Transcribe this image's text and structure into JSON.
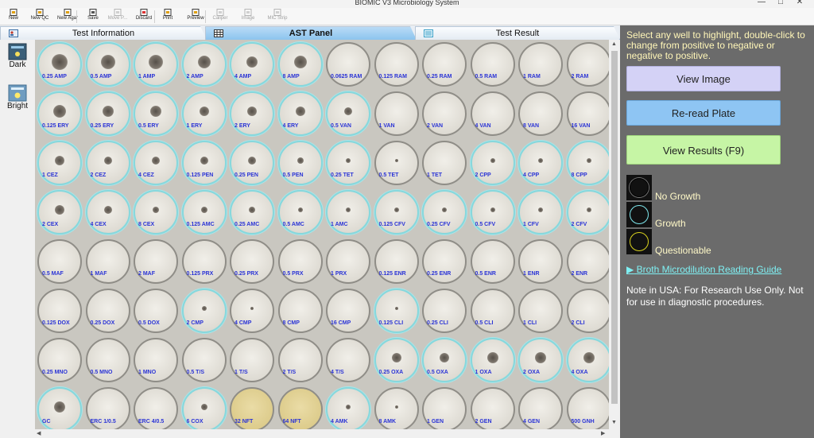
{
  "window": {
    "title": "BIOMIC V3 Microbiology System"
  },
  "toolbar": {
    "items": [
      {
        "label": "New",
        "icon": "new-file-icon",
        "disabled": false
      },
      {
        "label": "New QC",
        "icon": "qc-icon",
        "disabled": false
      },
      {
        "label": "New Agar",
        "icon": "agar-icon",
        "disabled": false
      },
      {
        "label": "Save",
        "icon": "save-icon",
        "disabled": false
      },
      {
        "label": "Move P...",
        "icon": "move-icon",
        "disabled": true
      },
      {
        "label": "Discard",
        "icon": "discard-icon",
        "disabled": false
      },
      {
        "label": "Print",
        "icon": "print-icon",
        "disabled": false
      },
      {
        "label": "Preview",
        "icon": "preview-icon",
        "disabled": false
      },
      {
        "label": "Caliper",
        "icon": "caliper-icon",
        "disabled": true
      },
      {
        "label": "Image",
        "icon": "image-icon",
        "disabled": true
      },
      {
        "label": "MIC Strip",
        "icon": "mic-strip-icon",
        "disabled": true
      }
    ]
  },
  "tabs": [
    {
      "label": "Test Information",
      "active": false
    },
    {
      "label": "AST Panel",
      "active": true
    },
    {
      "label": "Test Result",
      "active": false
    }
  ],
  "left_panel": {
    "dark_label": "Dark",
    "bright_label": "Bright"
  },
  "plate": {
    "rows": [
      [
        {
          "label": "0.25 AMP",
          "growth": true,
          "button": 20
        },
        {
          "label": "0.5 AMP",
          "growth": true,
          "button": 18
        },
        {
          "label": "1 AMP",
          "growth": true,
          "button": 18
        },
        {
          "label": "2 AMP",
          "growth": true,
          "button": 16
        },
        {
          "label": "4 AMP",
          "growth": true,
          "button": 14
        },
        {
          "label": "8 AMP",
          "growth": true,
          "button": 16
        },
        {
          "label": "0.0625 RAM",
          "growth": false,
          "button": 0
        },
        {
          "label": "0.125 RAM",
          "growth": false,
          "button": 0
        },
        {
          "label": "0.25 RAM",
          "growth": false,
          "button": 0
        },
        {
          "label": "0.5 RAM",
          "growth": false,
          "button": 0
        },
        {
          "label": "1 RAM",
          "growth": false,
          "button": 0
        },
        {
          "label": "2 RAM",
          "growth": false,
          "button": 0
        }
      ],
      [
        {
          "label": "0.125 ERY",
          "growth": true,
          "button": 16
        },
        {
          "label": "0.25 ERY",
          "growth": true,
          "button": 14
        },
        {
          "label": "0.5 ERY",
          "growth": true,
          "button": 14
        },
        {
          "label": "1 ERY",
          "growth": true,
          "button": 12
        },
        {
          "label": "2 ERY",
          "growth": true,
          "button": 12
        },
        {
          "label": "4 ERY",
          "growth": true,
          "button": 12
        },
        {
          "label": "0.5 VAN",
          "growth": true,
          "button": 10
        },
        {
          "label": "1 VAN",
          "growth": false,
          "button": 0
        },
        {
          "label": "2 VAN",
          "growth": false,
          "button": 0
        },
        {
          "label": "4 VAN",
          "growth": false,
          "button": 0
        },
        {
          "label": "8 VAN",
          "growth": false,
          "button": 0
        },
        {
          "label": "16 VAN",
          "growth": false,
          "button": 0
        }
      ],
      [
        {
          "label": "1 CEZ",
          "growth": true,
          "button": 12
        },
        {
          "label": "2 CEZ",
          "growth": true,
          "button": 10
        },
        {
          "label": "4 CEZ",
          "growth": true,
          "button": 10
        },
        {
          "label": "0.125 PEN",
          "growth": true,
          "button": 10
        },
        {
          "label": "0.25 PEN",
          "growth": true,
          "button": 10
        },
        {
          "label": "0.5 PEN",
          "growth": true,
          "button": 8
        },
        {
          "label": "0.25 TET",
          "growth": true,
          "button": 6
        },
        {
          "label": "0.5 TET",
          "growth": false,
          "button": 4
        },
        {
          "label": "1 TET",
          "growth": false,
          "button": 0
        },
        {
          "label": "2 CPP",
          "growth": true,
          "button": 6
        },
        {
          "label": "4 CPP",
          "growth": true,
          "button": 6
        },
        {
          "label": "8 CPP",
          "growth": true,
          "button": 6
        }
      ],
      [
        {
          "label": "2 CEX",
          "growth": true,
          "button": 12
        },
        {
          "label": "4 CEX",
          "growth": true,
          "button": 10
        },
        {
          "label": "8 CEX",
          "growth": true,
          "button": 8
        },
        {
          "label": "0.125 AMC",
          "growth": true,
          "button": 8
        },
        {
          "label": "0.25 AMC",
          "growth": true,
          "button": 8
        },
        {
          "label": "0.5 AMC",
          "growth": true,
          "button": 6
        },
        {
          "label": "1 AMC",
          "growth": true,
          "button": 6
        },
        {
          "label": "0.125 CFV",
          "growth": true,
          "button": 6
        },
        {
          "label": "0.25 CFV",
          "growth": true,
          "button": 6
        },
        {
          "label": "0.5 CFV",
          "growth": true,
          "button": 6
        },
        {
          "label": "1 CFV",
          "growth": true,
          "button": 6
        },
        {
          "label": "2 CFV",
          "growth": true,
          "button": 6
        }
      ],
      [
        {
          "label": "0.5 MAF",
          "growth": false,
          "button": 0
        },
        {
          "label": "1 MAF",
          "growth": false,
          "button": 0
        },
        {
          "label": "2 MAF",
          "growth": false,
          "button": 0
        },
        {
          "label": "0.125 PRX",
          "growth": false,
          "button": 0
        },
        {
          "label": "0.25 PRX",
          "growth": false,
          "button": 0
        },
        {
          "label": "0.5 PRX",
          "growth": false,
          "button": 0
        },
        {
          "label": "1 PRX",
          "growth": false,
          "button": 0
        },
        {
          "label": "0.125 ENR",
          "growth": false,
          "button": 0
        },
        {
          "label": "0.25 ENR",
          "growth": false,
          "button": 0
        },
        {
          "label": "0.5 ENR",
          "growth": false,
          "button": 0
        },
        {
          "label": "1 ENR",
          "growth": false,
          "button": 0
        },
        {
          "label": "2 ENR",
          "growth": false,
          "button": 0
        }
      ],
      [
        {
          "label": "0.125 DOX",
          "growth": false,
          "button": 0
        },
        {
          "label": "0.25 DOX",
          "growth": false,
          "button": 0
        },
        {
          "label": "0.5 DOX",
          "growth": false,
          "button": 0
        },
        {
          "label": "2 CMP",
          "growth": true,
          "button": 6
        },
        {
          "label": "4 CMP",
          "growth": false,
          "button": 4
        },
        {
          "label": "8 CMP",
          "growth": false,
          "button": 0
        },
        {
          "label": "16 CMP",
          "growth": false,
          "button": 0
        },
        {
          "label": "0.125 CLI",
          "growth": true,
          "button": 4
        },
        {
          "label": "0.25 CLI",
          "growth": false,
          "button": 0
        },
        {
          "label": "0.5 CLI",
          "growth": false,
          "button": 0
        },
        {
          "label": "1 CLI",
          "growth": false,
          "button": 0
        },
        {
          "label": "2 CLI",
          "growth": false,
          "button": 0
        }
      ],
      [
        {
          "label": "0.25 MNO",
          "growth": false,
          "button": 0
        },
        {
          "label": "0.5 MNO",
          "growth": false,
          "button": 0
        },
        {
          "label": "1 MNO",
          "growth": false,
          "button": 0
        },
        {
          "label": "0.5 T/S",
          "growth": false,
          "button": 0
        },
        {
          "label": "1 T/S",
          "growth": false,
          "button": 0
        },
        {
          "label": "2 T/S",
          "growth": false,
          "button": 0
        },
        {
          "label": "4 T/S",
          "growth": false,
          "button": 0
        },
        {
          "label": "0.25 OXA",
          "growth": true,
          "button": 12
        },
        {
          "label": "0.5 OXA",
          "growth": true,
          "button": 12
        },
        {
          "label": "1 OXA",
          "growth": true,
          "button": 14
        },
        {
          "label": "2 OXA",
          "growth": true,
          "button": 14
        },
        {
          "label": "4 OXA",
          "growth": true,
          "button": 14
        }
      ],
      [
        {
          "label": "GC",
          "growth": true,
          "button": 14
        },
        {
          "label": "ERC 1/0.5",
          "growth": false,
          "button": 0
        },
        {
          "label": "ERC 4/0.5",
          "growth": false,
          "button": 0
        },
        {
          "label": "6 COX",
          "growth": true,
          "button": 8
        },
        {
          "label": "32 NFT",
          "growth": false,
          "button": 0,
          "tint": "yellow"
        },
        {
          "label": "64 NFT",
          "growth": false,
          "button": 0,
          "tint": "yellow"
        },
        {
          "label": "4 AMK",
          "growth": true,
          "button": 6
        },
        {
          "label": "8 AMK",
          "growth": false,
          "button": 4
        },
        {
          "label": "1 GEN",
          "growth": false,
          "button": 0
        },
        {
          "label": "2 GEN",
          "growth": false,
          "button": 0
        },
        {
          "label": "4 GEN",
          "growth": false,
          "button": 0
        },
        {
          "label": "500 GNH",
          "growth": false,
          "button": 0
        }
      ]
    ]
  },
  "right_panel": {
    "instructions": "Select any well to highlight, double-click to change from positive to negative or negative to positive.",
    "view_image": "View Image",
    "reread_plate": "Re-read Plate",
    "view_results": "View Results (F9)",
    "legend": [
      {
        "label": "No Growth",
        "ring_color": "#000000"
      },
      {
        "label": "Growth",
        "ring_color": "#7fe8ee"
      },
      {
        "label": "Questionable",
        "ring_color": "#d9d21e"
      }
    ],
    "guide_link": "Broth Microdilution Reading Guide",
    "note": "Note in USA: For Research Use Only. Not for use in diagnostic procedures."
  }
}
